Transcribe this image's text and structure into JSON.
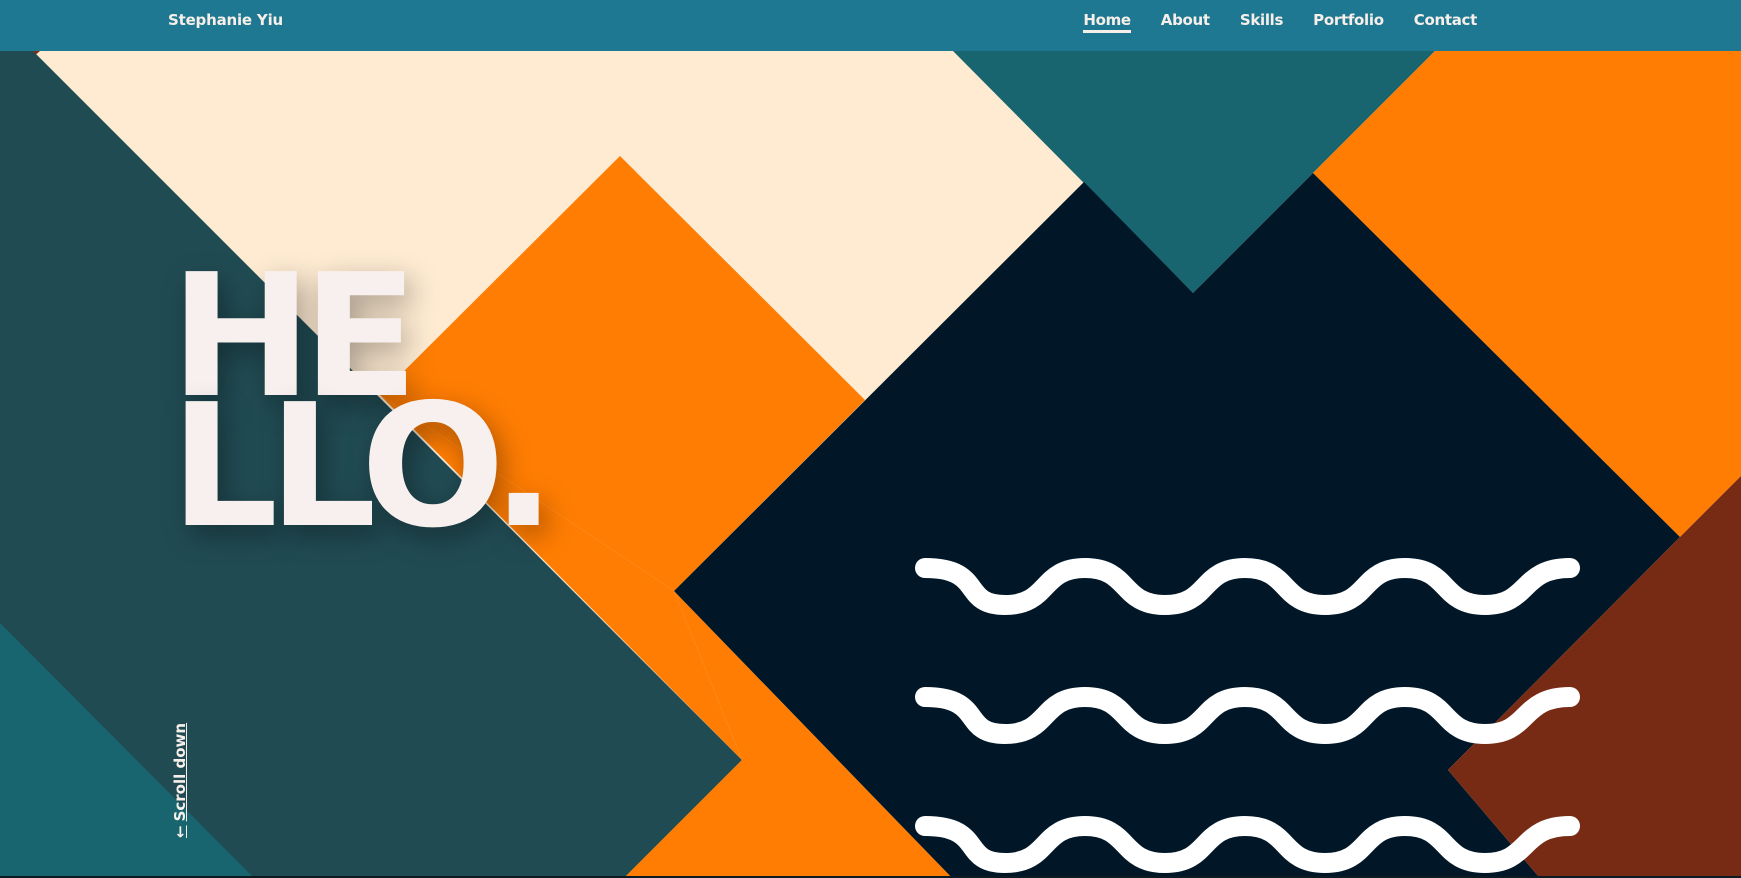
{
  "nav": {
    "brand": "Stephanie Yiu",
    "links": [
      {
        "label": "Home",
        "active": true
      },
      {
        "label": "About",
        "active": false
      },
      {
        "label": "Skills",
        "active": false
      },
      {
        "label": "Portfolio",
        "active": false
      },
      {
        "label": "Contact",
        "active": false
      }
    ]
  },
  "hero": {
    "headline_line1": "HE",
    "headline_line2": "LLO.",
    "scroll_label": "Scroll down",
    "scroll_icon": "arrow-down-icon"
  },
  "colors": {
    "nav_bg": "#1f7892",
    "cream": "#feebd2",
    "orange": "#ff7d03",
    "dark_teal": "#214b53",
    "teal": "#18646f",
    "navy": "#011727",
    "rust": "#782b14",
    "text": "#f8f0ee"
  }
}
